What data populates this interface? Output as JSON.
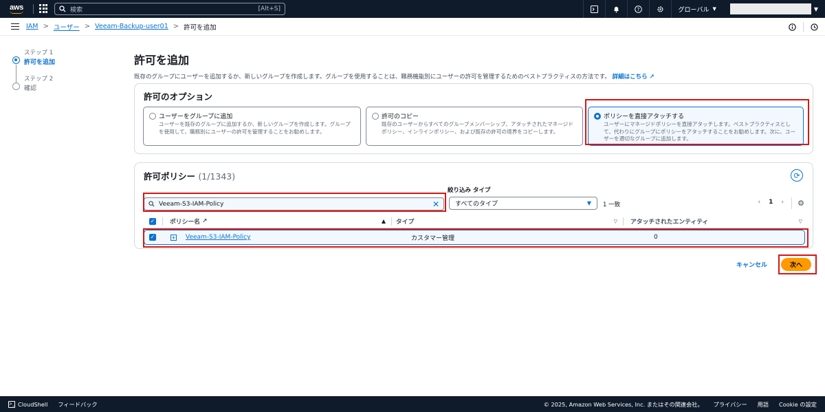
{
  "topnav": {
    "search_placeholder": "検索",
    "search_shortcut": "[Alt+S]",
    "region": "グローバル"
  },
  "breadcrumb": {
    "items": [
      "IAM",
      "ユーザー",
      "Veeam-Backup-user01"
    ],
    "current": "許可を追加"
  },
  "steps": [
    {
      "label": "ステップ 1",
      "name": "許可を追加"
    },
    {
      "label": "ステップ 2",
      "name": "確認"
    }
  ],
  "page": {
    "title": "許可を追加",
    "description": "既存のグループにユーザーを追加するか、新しいグループを作成します。グループを使用することは、職務機能別にユーザーの許可を管理するためのベストプラクティスの方法です。",
    "learn_more": "詳細はこちら"
  },
  "options": {
    "title": "許可のオプション",
    "tiles": [
      {
        "title": "ユーザーをグループに追加",
        "desc1": "ユーザーを既存のグループに追加するか、新しいグループを作成します。グループ",
        "desc2": "を使用して、職務別にユーザーの許可を管理することをお勧めします。",
        "desc3": ""
      },
      {
        "title": "許可のコピー",
        "desc1": "既存のユーザーからすべてのグループメンバーシップ、アタッチされたマネージド",
        "desc2": "ポリシー、インラインポリシー、および既存の許可の境界をコピーします。",
        "desc3": ""
      },
      {
        "title": "ポリシーを直接アタッチする",
        "desc1": "ユーザーにマネージドポリシーを直接アタッチします。ベストプラクティスとし",
        "desc2": "て、代わりにグループにポリシーをアタッチすることをお勧めします。次に、ユー",
        "desc3": "ザーを適切なグループに追加します。"
      }
    ]
  },
  "policies": {
    "title": "許可ポリシー",
    "count": "(1/1343)",
    "filter_label": "絞り込み タイプ",
    "search_value": "Veeam-S3-IAM-Policy",
    "type_filter": "すべてのタイプ",
    "matches": "1 一致",
    "page": "1",
    "columns": [
      "ポリシー名",
      "タイプ",
      "アタッチされたエンティティ"
    ],
    "rows": [
      {
        "name": "Veeam-S3-IAM-Policy",
        "type": "カスタマー管理",
        "entities": "0"
      }
    ]
  },
  "actions": {
    "cancel": "キャンセル",
    "next": "次へ"
  },
  "footer": {
    "cloudshell": "CloudShell",
    "feedback": "フィードバック",
    "copyright": "© 2025, Amazon Web Services, Inc. またはその関連会社。",
    "privacy": "プライバシー",
    "terms": "用語",
    "cookies": "Cookie の設定"
  },
  "colors": {
    "nav_bg": "#0f1b2a",
    "link": "#0972d3",
    "primary_button": "#ff9900",
    "highlight_border": "#d91515"
  }
}
